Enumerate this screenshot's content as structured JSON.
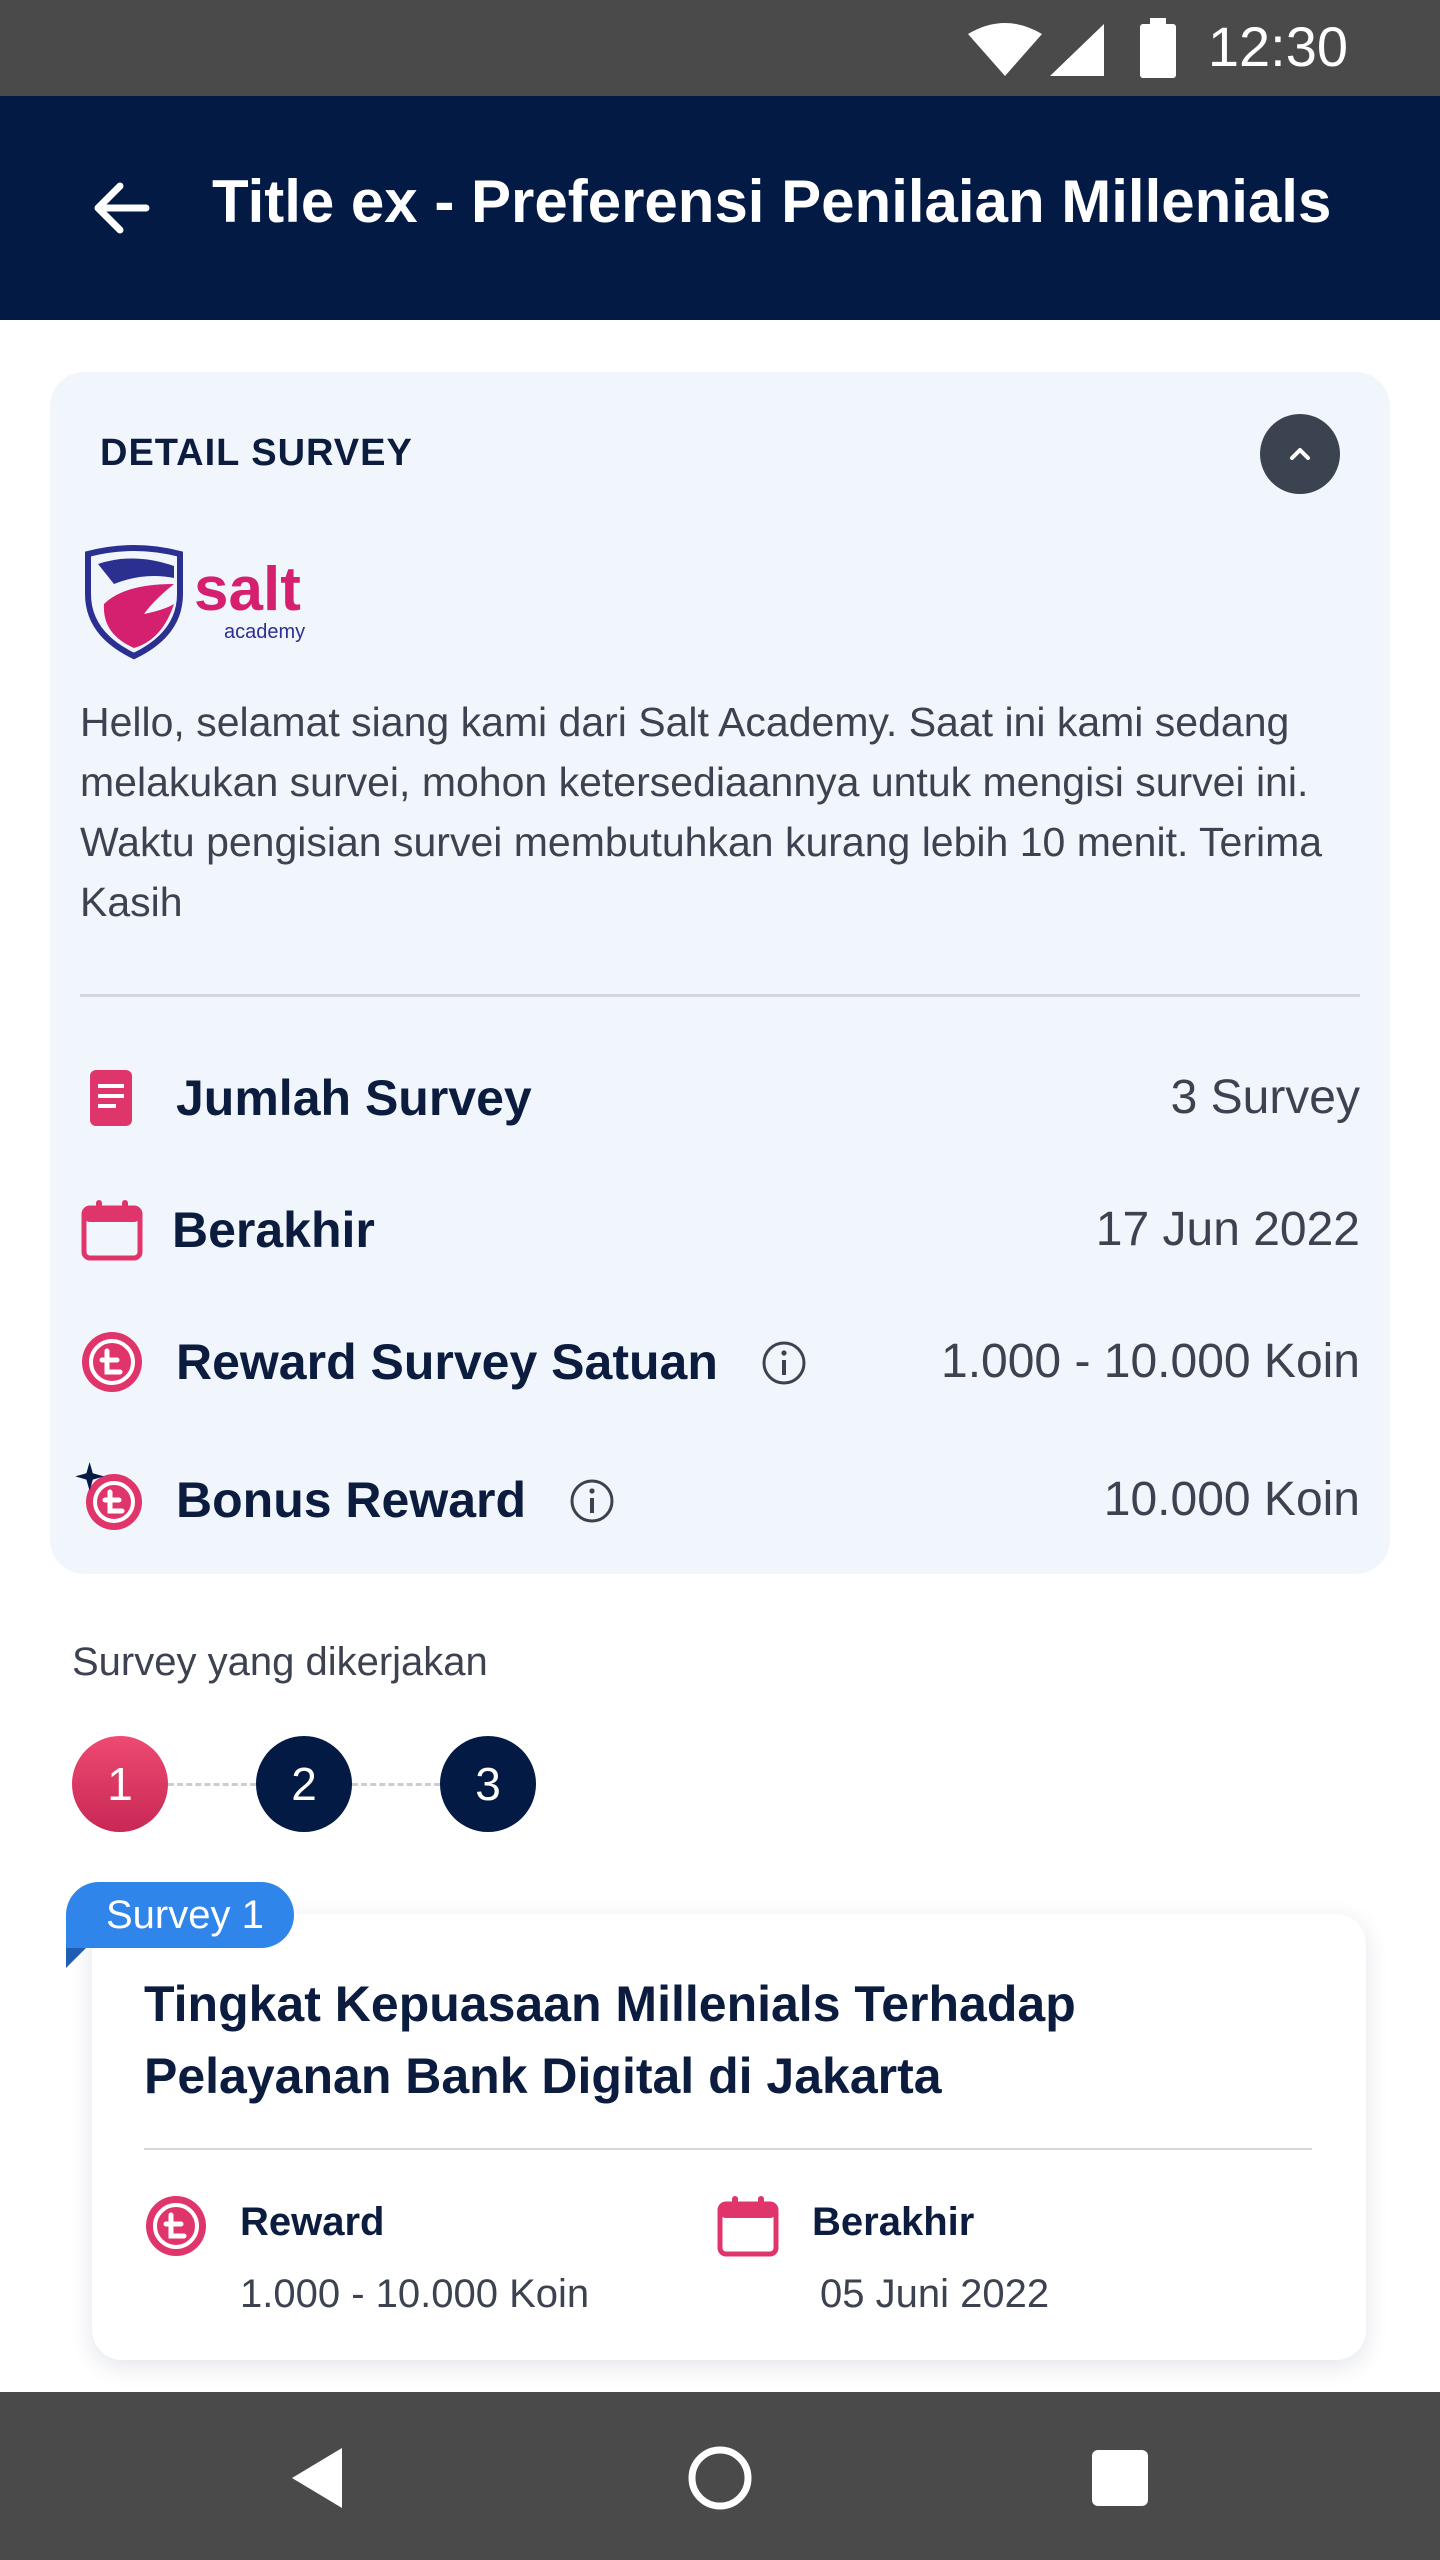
{
  "status_bar": {
    "time": "12:30",
    "icons": [
      "wifi-icon",
      "cell-signal-icon",
      "battery-icon"
    ]
  },
  "app_bar": {
    "title": "Title ex - Preferensi Penilaian Millenials",
    "back_icon": "arrow-left-icon"
  },
  "detail": {
    "heading": "DETAIL SURVEY",
    "collapse_icon": "chevron-up-icon",
    "logo_text": "salt",
    "logo_subtext": "academy",
    "description": "Hello, selamat siang kami dari Salt Academy. Saat ini kami sedang melakukan survei, mohon ketersediaannya untuk mengisi survei ini. Waktu pengisian survei membutuhkan kurang lebih 10 menit. Terima Kasih",
    "rows": [
      {
        "label": "Jumlah Survey",
        "value": "3 Survey",
        "icon": "document-icon"
      },
      {
        "label": "Berakhir",
        "value": "17 Jun 2022",
        "icon": "calendar-icon"
      },
      {
        "label": "Reward Survey Satuan",
        "value": "1.000 - 10.000 Koin",
        "icon": "coin-icon",
        "info": true
      },
      {
        "label": "Bonus Reward",
        "value": "10.000 Koin",
        "icon": "bonus-coin-icon",
        "info": true
      }
    ]
  },
  "progress": {
    "label": "Survey yang dikerjakan",
    "steps": [
      "1",
      "2",
      "3"
    ],
    "active_step": 1
  },
  "survey_card": {
    "badge": "Survey 1",
    "title": "Tingkat Kepuasaan Millenials Terhadap Pelayanan Bank Digital di Jakarta",
    "reward_label": "Reward",
    "reward_value": "1.000 - 10.000 Koin",
    "end_label": "Berakhir",
    "end_value": "05 Juni 2022"
  },
  "colors": {
    "primary_dark": "#031a44",
    "accent_pink": "#e0356a",
    "badge_blue": "#2f85e9",
    "card_bg": "#f1f6fd"
  },
  "nav_bar": {
    "icons": [
      "back-triangle-icon",
      "home-circle-icon",
      "recents-square-icon"
    ]
  }
}
